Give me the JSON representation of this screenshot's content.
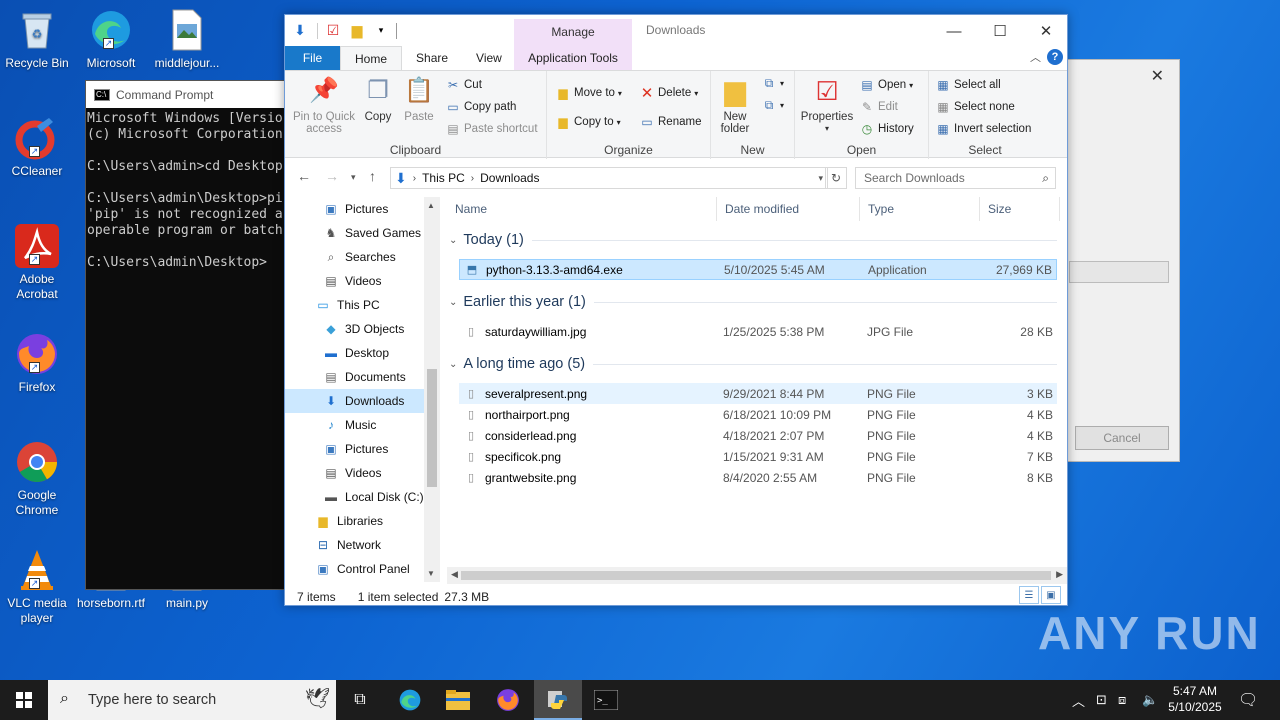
{
  "desktop": {
    "icons": [
      {
        "label": "Recycle Bin",
        "icon": "recycle-bin-icon"
      },
      {
        "label": "Microsoft Edge",
        "icon": "edge-icon"
      },
      {
        "label": "middlejour...",
        "icon": "image-file-icon"
      },
      {
        "label": "CCleaner",
        "icon": "ccleaner-icon"
      },
      {
        "label": "Adobe Acrobat",
        "icon": "acrobat-icon"
      },
      {
        "label": "Firefox",
        "icon": "firefox-icon"
      },
      {
        "label": "Google Chrome",
        "icon": "chrome-icon"
      },
      {
        "label": "VLC media player",
        "icon": "vlc-icon"
      },
      {
        "label": "horseborn.rtf",
        "icon": "rtf-file-icon"
      },
      {
        "label": "main.py",
        "icon": "py-file-icon"
      }
    ]
  },
  "cmd": {
    "title": "Command Prompt",
    "lines": "Microsoft Windows [Versio\n(c) Microsoft Corporation\n\nC:\\Users\\admin>cd Desktop\n\nC:\\Users\\admin\\Desktop>pi\n'pip' is not recognized a\noperable program or batch\n\nC:\\Users\\admin\\Desktop>"
  },
  "dialog": {
    "cancel_label": "Cancel"
  },
  "explorer": {
    "title": "Downloads",
    "manage_label": "Manage",
    "tabs": {
      "file": "File",
      "home": "Home",
      "share": "Share",
      "view": "View",
      "app_tools": "Application Tools"
    },
    "ribbon": {
      "clipboard": {
        "label": "Clipboard",
        "pin": "Pin to Quick access",
        "copy": "Copy",
        "paste": "Paste",
        "cut": "Cut",
        "copy_path": "Copy path",
        "paste_shortcut": "Paste shortcut"
      },
      "organize": {
        "label": "Organize",
        "move_to": "Move to",
        "copy_to": "Copy to",
        "delete": "Delete",
        "rename": "Rename"
      },
      "new": {
        "label": "New",
        "new_folder": "New folder"
      },
      "open": {
        "label": "Open",
        "properties": "Properties",
        "open": "Open",
        "edit": "Edit",
        "history": "History"
      },
      "select": {
        "label": "Select",
        "select_all": "Select all",
        "select_none": "Select none",
        "invert": "Invert selection"
      }
    },
    "breadcrumb": [
      "This PC",
      "Downloads"
    ],
    "search_placeholder": "Search Downloads",
    "nav_items": [
      {
        "label": "Pictures",
        "icon": "pictures-icon",
        "indent": 2
      },
      {
        "label": "Saved Games",
        "icon": "saved-games-icon",
        "indent": 2
      },
      {
        "label": "Searches",
        "icon": "searches-icon",
        "indent": 2
      },
      {
        "label": "Videos",
        "icon": "videos-icon",
        "indent": 2
      },
      {
        "label": "This PC",
        "icon": "this-pc-icon",
        "indent": 1
      },
      {
        "label": "3D Objects",
        "icon": "3d-objects-icon",
        "indent": 2
      },
      {
        "label": "Desktop",
        "icon": "desktop-icon",
        "indent": 2
      },
      {
        "label": "Documents",
        "icon": "documents-icon",
        "indent": 2
      },
      {
        "label": "Downloads",
        "icon": "downloads-icon",
        "indent": 2,
        "selected": true
      },
      {
        "label": "Music",
        "icon": "music-icon",
        "indent": 2
      },
      {
        "label": "Pictures",
        "icon": "pictures-icon",
        "indent": 2
      },
      {
        "label": "Videos",
        "icon": "videos-icon",
        "indent": 2
      },
      {
        "label": "Local Disk (C:)",
        "icon": "local-disk-icon",
        "indent": 2
      },
      {
        "label": "Libraries",
        "icon": "libraries-icon",
        "indent": 1
      },
      {
        "label": "Network",
        "icon": "network-icon",
        "indent": 1
      },
      {
        "label": "Control Panel",
        "icon": "control-panel-icon",
        "indent": 1
      }
    ],
    "columns": [
      "Name",
      "Date modified",
      "Type",
      "Size"
    ],
    "groups": [
      {
        "title": "Today (1)",
        "files": [
          {
            "name": "python-3.13.3-amd64.exe",
            "date": "5/10/2025 5:45 AM",
            "type": "Application",
            "size": "27,969 KB",
            "icon": "installer-icon",
            "state": "selected"
          }
        ]
      },
      {
        "title": "Earlier this year (1)",
        "files": [
          {
            "name": "saturdaywilliam.jpg",
            "date": "1/25/2025 5:38 PM",
            "type": "JPG File",
            "size": "28 KB",
            "icon": "image-file-icon",
            "state": ""
          }
        ]
      },
      {
        "title": "A long time ago (5)",
        "files": [
          {
            "name": "severalpresent.png",
            "date": "9/29/2021 8:44 PM",
            "type": "PNG File",
            "size": "3 KB",
            "icon": "image-file-icon",
            "state": "hover"
          },
          {
            "name": "northairport.png",
            "date": "6/18/2021 10:09 PM",
            "type": "PNG File",
            "size": "4 KB",
            "icon": "image-file-icon",
            "state": ""
          },
          {
            "name": "considerlead.png",
            "date": "4/18/2021 2:07 PM",
            "type": "PNG File",
            "size": "4 KB",
            "icon": "image-file-icon",
            "state": ""
          },
          {
            "name": "specificok.png",
            "date": "1/15/2021 9:31 AM",
            "type": "PNG File",
            "size": "7 KB",
            "icon": "image-file-icon",
            "state": ""
          },
          {
            "name": "grantwebsite.png",
            "date": "8/4/2020 2:55 AM",
            "type": "PNG File",
            "size": "8 KB",
            "icon": "image-file-icon",
            "state": ""
          }
        ]
      }
    ],
    "status": {
      "items": "7 items",
      "selected": "1 item selected",
      "size": "27.3 MB"
    }
  },
  "taskbar": {
    "search_placeholder": "Type here to search",
    "time": "5:47 AM",
    "date": "5/10/2025"
  },
  "watermark": "ANY RUN"
}
